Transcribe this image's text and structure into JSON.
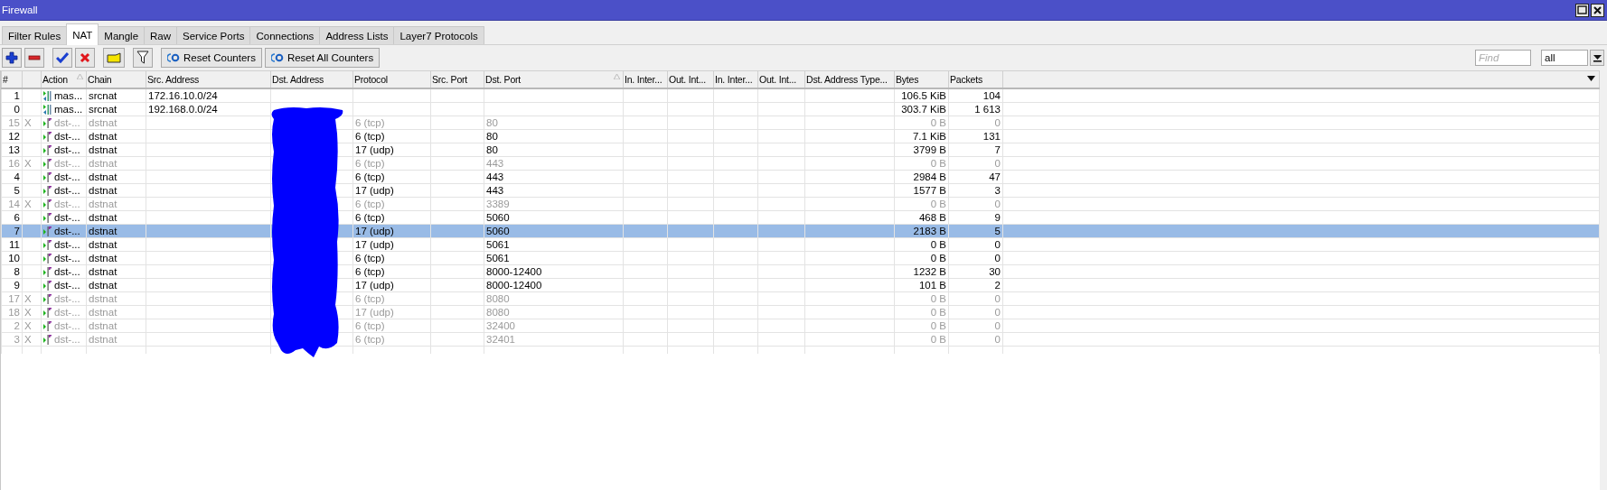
{
  "window": {
    "title": "Firewall"
  },
  "tabs": [
    {
      "label": "Filter Rules",
      "selected": false
    },
    {
      "label": "NAT",
      "selected": true
    },
    {
      "label": "Mangle",
      "selected": false
    },
    {
      "label": "Raw",
      "selected": false
    },
    {
      "label": "Service Ports",
      "selected": false
    },
    {
      "label": "Connections",
      "selected": false
    },
    {
      "label": "Address Lists",
      "selected": false
    },
    {
      "label": "Layer7 Protocols",
      "selected": false
    }
  ],
  "toolbar": {
    "buttons": [
      {
        "kind": "add"
      },
      {
        "kind": "remove"
      },
      {
        "kind": "enable"
      },
      {
        "kind": "disable"
      },
      {
        "kind": "comment"
      },
      {
        "kind": "filter"
      },
      {
        "kind": "reset",
        "label": "Reset Counters"
      },
      {
        "kind": "reset",
        "label": "Reset All Counters"
      }
    ],
    "find": {
      "placeholder": "Find"
    },
    "scope": {
      "value": "all"
    }
  },
  "table": {
    "redacted": true,
    "columns": [
      {
        "label": "#",
        "sorted": false
      },
      {
        "sorted": false
      },
      {
        "label": "Action",
        "sorted": true
      },
      {
        "label": "Chain",
        "sorted": false
      },
      {
        "label": "Src. Address",
        "sorted": false
      },
      {
        "label": "Dst. Address",
        "sorted": false
      },
      {
        "label": "Protocol",
        "sorted": false
      },
      {
        "label": "Src. Port",
        "sorted": false
      },
      {
        "label": "Dst. Port",
        "sorted": true
      },
      {
        "label": "In. Inter...",
        "sorted": false
      },
      {
        "label": "Out. Int...",
        "sorted": false
      },
      {
        "label": "In. Inter...",
        "sorted": false
      },
      {
        "label": "Out. Int...",
        "sorted": false
      },
      {
        "label": "Dst. Address Type...",
        "sorted": false
      },
      {
        "label": "Bytes",
        "sorted": false
      },
      {
        "label": "Packets",
        "sorted": false
      }
    ],
    "rows": [
      {
        "num": "1",
        "disabled": false,
        "selected": false,
        "kind": "masquerade",
        "action": "mas...",
        "chain": "srcnat",
        "src": "172.16.10.0/24",
        "bytes": "106.5 KiB",
        "packets": "104"
      },
      {
        "num": "0",
        "disabled": false,
        "selected": false,
        "kind": "masquerade",
        "action": "mas...",
        "chain": "srcnat",
        "src": "192.168.0.0/24",
        "bytes": "303.7 KiB",
        "packets": "1 613"
      },
      {
        "num": "15",
        "flag": "X",
        "disabled": true,
        "selected": false,
        "kind": "dstnat",
        "action": "dst-...",
        "chain": "dstnat",
        "src": "",
        "protocol": "6 (tcp)",
        "dst_port": "80",
        "bytes": "0 B",
        "packets": "0"
      },
      {
        "num": "12",
        "disabled": false,
        "selected": false,
        "kind": "dstnat",
        "action": "dst-...",
        "chain": "dstnat",
        "src": "",
        "protocol": "6 (tcp)",
        "dst_port": "80",
        "bytes": "7.1 KiB",
        "packets": "131"
      },
      {
        "num": "13",
        "disabled": false,
        "selected": false,
        "kind": "dstnat",
        "action": "dst-...",
        "chain": "dstnat",
        "src": "",
        "protocol": "17 (udp)",
        "dst_port": "80",
        "bytes": "3799 B",
        "packets": "7"
      },
      {
        "num": "16",
        "flag": "X",
        "disabled": true,
        "selected": false,
        "kind": "dstnat",
        "action": "dst-...",
        "chain": "dstnat",
        "src": "",
        "protocol": "6 (tcp)",
        "dst_port": "443",
        "bytes": "0 B",
        "packets": "0"
      },
      {
        "num": "4",
        "disabled": false,
        "selected": false,
        "kind": "dstnat",
        "action": "dst-...",
        "chain": "dstnat",
        "src": "",
        "protocol": "6 (tcp)",
        "dst_port": "443",
        "bytes": "2984 B",
        "packets": "47"
      },
      {
        "num": "5",
        "disabled": false,
        "selected": false,
        "kind": "dstnat",
        "action": "dst-...",
        "chain": "dstnat",
        "src": "",
        "protocol": "17 (udp)",
        "dst_port": "443",
        "bytes": "1577 B",
        "packets": "3"
      },
      {
        "num": "14",
        "flag": "X",
        "disabled": true,
        "selected": false,
        "kind": "dstnat",
        "action": "dst-...",
        "chain": "dstnat",
        "src": "",
        "protocol": "6 (tcp)",
        "dst_port": "3389",
        "bytes": "0 B",
        "packets": "0"
      },
      {
        "num": "6",
        "disabled": false,
        "selected": false,
        "kind": "dstnat",
        "action": "dst-...",
        "chain": "dstnat",
        "src": "",
        "protocol": "6 (tcp)",
        "dst_port": "5060",
        "bytes": "468 B",
        "packets": "9"
      },
      {
        "num": "7",
        "disabled": false,
        "selected": true,
        "kind": "dstnat",
        "action": "dst-...",
        "chain": "dstnat",
        "src": "",
        "protocol": "17 (udp)",
        "dst_port": "5060",
        "bytes": "2183 B",
        "packets": "5"
      },
      {
        "num": "11",
        "disabled": false,
        "selected": false,
        "kind": "dstnat",
        "action": "dst-...",
        "chain": "dstnat",
        "src": "",
        "protocol": "17 (udp)",
        "dst_port": "5061",
        "bytes": "0 B",
        "packets": "0"
      },
      {
        "num": "10",
        "disabled": false,
        "selected": false,
        "kind": "dstnat",
        "action": "dst-...",
        "chain": "dstnat",
        "src": "",
        "protocol": "6 (tcp)",
        "dst_port": "5061",
        "bytes": "0 B",
        "packets": "0"
      },
      {
        "num": "8",
        "disabled": false,
        "selected": false,
        "kind": "dstnat",
        "action": "dst-...",
        "chain": "dstnat",
        "src": "",
        "protocol": "6 (tcp)",
        "dst_port": "8000-12400",
        "bytes": "1232 B",
        "packets": "30"
      },
      {
        "num": "9",
        "disabled": false,
        "selected": false,
        "kind": "dstnat",
        "action": "dst-...",
        "chain": "dstnat",
        "src": "",
        "protocol": "17 (udp)",
        "dst_port": "8000-12400",
        "bytes": "101 B",
        "packets": "2"
      },
      {
        "num": "17",
        "flag": "X",
        "disabled": true,
        "selected": false,
        "kind": "dstnat",
        "action": "dst-...",
        "chain": "dstnat",
        "src": "",
        "protocol": "6 (tcp)",
        "dst_port": "8080",
        "bytes": "0 B",
        "packets": "0"
      },
      {
        "num": "18",
        "flag": "X",
        "disabled": true,
        "selected": false,
        "kind": "dstnat",
        "action": "dst-...",
        "chain": "dstnat",
        "src": "",
        "protocol": "17 (udp)",
        "dst_port": "8080",
        "bytes": "0 B",
        "packets": "0"
      },
      {
        "num": "2",
        "flag": "X",
        "disabled": true,
        "selected": false,
        "kind": "dstnat",
        "action": "dst-...",
        "chain": "dstnat",
        "src": "",
        "protocol": "6 (tcp)",
        "dst_port": "32400",
        "bytes": "0 B",
        "packets": "0"
      },
      {
        "num": "3",
        "flag": "X",
        "disabled": true,
        "selected": false,
        "kind": "dstnat",
        "action": "dst-...",
        "chain": "dstnat",
        "src": "",
        "protocol": "6 (tcp)",
        "dst_port": "32401",
        "bytes": "0 B",
        "packets": "0"
      }
    ]
  }
}
